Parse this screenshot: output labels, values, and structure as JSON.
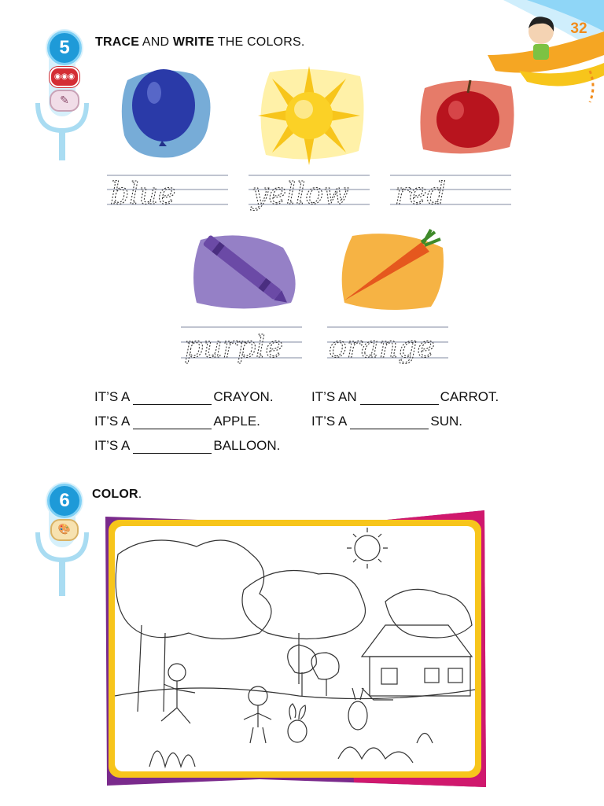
{
  "page": {
    "number": "32"
  },
  "exercise5": {
    "number": "5",
    "instruction_bold1": "TRACE",
    "instruction_mid": " AND ",
    "instruction_bold2": "WRITE",
    "instruction_end": " THE COLORS.",
    "words": [
      "blue",
      "yellow",
      "red",
      "purple",
      "orange"
    ],
    "sentences": {
      "s1_pre": "IT’S A",
      "s1_post": "CRAYON.",
      "s2_pre": "IT’S AN",
      "s2_post": "CARROT.",
      "s3_pre": "IT’S A",
      "s3_post": "APPLE.",
      "s4_pre": "IT’S A",
      "s4_post": "SUN.",
      "s5_pre": "IT’S A",
      "s5_post": "BALLOON."
    }
  },
  "exercise6": {
    "number": "6",
    "instruction_bold": "COLOR",
    "instruction_end": "."
  },
  "colors": {
    "badge_blue": "#1e9ad8",
    "page_number_orange": "#f28c1b",
    "frame_yellow": "#f7c51b",
    "frame_purple": "#7a2a8c",
    "frame_magenta": "#d0186d"
  }
}
